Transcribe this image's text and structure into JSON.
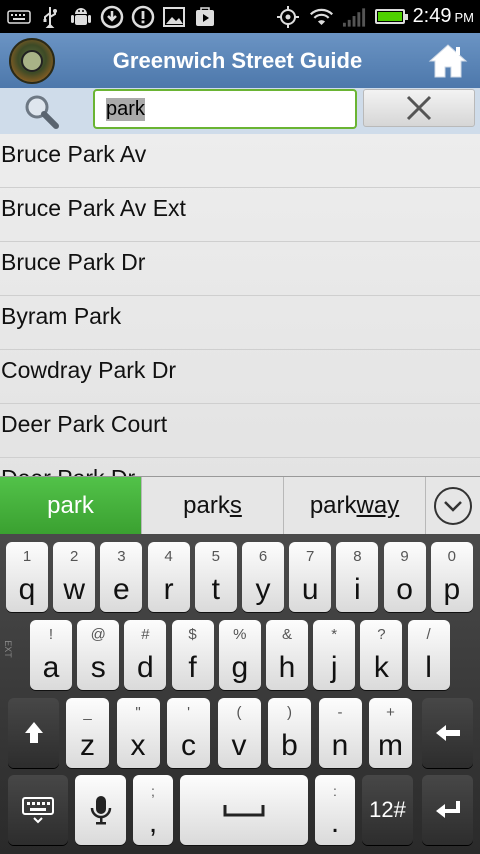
{
  "status_bar": {
    "time": "2:49",
    "ampm": "PM",
    "left_icons": [
      "keyboard-icon",
      "usb-icon",
      "android-debug-icon",
      "download-icon",
      "alert-icon",
      "image-icon",
      "play-store-icon"
    ],
    "right_icons": [
      "gps-icon",
      "wifi-icon",
      "signal-icon",
      "battery-icon"
    ],
    "battery_level": 1.0
  },
  "app_bar": {
    "title": "Greenwich Street Guide",
    "logo_icon": "town-seal-icon",
    "home_icon": "home-icon"
  },
  "search": {
    "value": "park",
    "search_icon": "search-icon",
    "clear_icon": "close-icon",
    "accent": "#6ab433"
  },
  "results": [
    "Bruce Park Av",
    "Bruce Park Av Ext",
    "Bruce Park Dr",
    "Byram Park",
    "Cowdray Park Dr",
    "Deer Park Court",
    "Deer Park Dr"
  ],
  "suggestions": {
    "first": "park",
    "second_prefix": "park",
    "second_suffix": "s",
    "third_prefix": "park",
    "third_suffix": "way",
    "more_icon": "chevron-down-icon"
  },
  "keyboard": {
    "row1": [
      {
        "k": "q",
        "h": "1"
      },
      {
        "k": "w",
        "h": "2"
      },
      {
        "k": "e",
        "h": "3"
      },
      {
        "k": "r",
        "h": "4"
      },
      {
        "k": "t",
        "h": "5"
      },
      {
        "k": "y",
        "h": "6"
      },
      {
        "k": "u",
        "h": "7"
      },
      {
        "k": "i",
        "h": "8"
      },
      {
        "k": "o",
        "h": "9"
      },
      {
        "k": "p",
        "h": "0"
      }
    ],
    "row2": [
      {
        "k": "a",
        "h": "!"
      },
      {
        "k": "s",
        "h": "@"
      },
      {
        "k": "d",
        "h": "#"
      },
      {
        "k": "f",
        "h": "$"
      },
      {
        "k": "g",
        "h": "%"
      },
      {
        "k": "h",
        "h": "&"
      },
      {
        "k": "j",
        "h": "*"
      },
      {
        "k": "k",
        "h": "?"
      },
      {
        "k": "l",
        "h": "/"
      }
    ],
    "row3": [
      {
        "k": "z",
        "h": "_"
      },
      {
        "k": "x",
        "h": "\""
      },
      {
        "k": "c",
        "h": "'"
      },
      {
        "k": "v",
        "h": "("
      },
      {
        "k": "b",
        "h": ")"
      },
      {
        "k": "n",
        "h": "-"
      },
      {
        "k": "m",
        "h": "+"
      }
    ],
    "comma_key": ",",
    "comma_hint": ";",
    "period_key": ".",
    "period_hint": ":",
    "numbers_key": "12#",
    "side_label": "EXT"
  }
}
